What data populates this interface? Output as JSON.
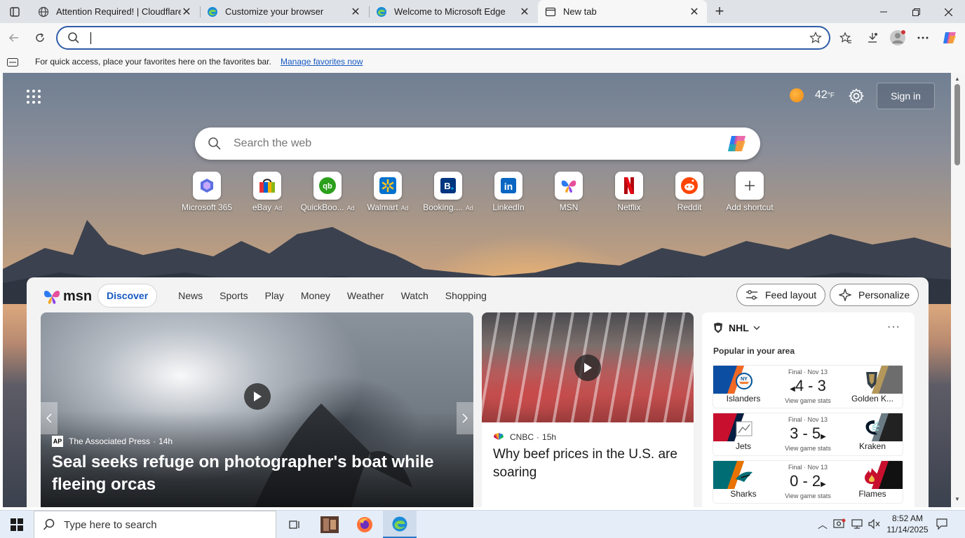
{
  "tabs": [
    {
      "title": "Attention Required! | Cloudflare",
      "icon": "globe-icon"
    },
    {
      "title": "Customize your browser",
      "icon": "edge-icon"
    },
    {
      "title": "Welcome to Microsoft Edge",
      "icon": "edge-icon"
    },
    {
      "title": "New tab",
      "icon": "newtab-icon",
      "active": true
    }
  ],
  "address_bar": {
    "value": "",
    "placeholder": ""
  },
  "favorites_bar": {
    "message": "For quick access, place your favorites here on the favorites bar.",
    "link": "Manage favorites now"
  },
  "ntp": {
    "weather": {
      "temp": "42",
      "unit": "°F",
      "icon": "sun-icon"
    },
    "sign_in": "Sign in",
    "search_placeholder": "Search the web",
    "shortcuts": [
      {
        "label": "Microsoft 365",
        "ad": ""
      },
      {
        "label": "eBay",
        "ad": "Ad"
      },
      {
        "label": "QuickBoo...",
        "ad": "Ad"
      },
      {
        "label": "Walmart",
        "ad": "Ad"
      },
      {
        "label": "Booking....",
        "ad": "Ad"
      },
      {
        "label": "LinkedIn",
        "ad": ""
      },
      {
        "label": "MSN",
        "ad": ""
      },
      {
        "label": "Netflix",
        "ad": ""
      },
      {
        "label": "Reddit",
        "ad": ""
      },
      {
        "label": "Add shortcut",
        "ad": ""
      }
    ]
  },
  "feed": {
    "brand": "msn",
    "nav": [
      "Discover",
      "News",
      "Sports",
      "Play",
      "Money",
      "Weather",
      "Watch",
      "Shopping"
    ],
    "feed_layout": "Feed layout",
    "personalize": "Personalize",
    "main_story": {
      "source": "The Associated Press",
      "source_badge": "AP",
      "age": "14h",
      "headline": "Seal seeks refuge on photographer's boat while fleeing orcas"
    },
    "second_story": {
      "source": "CNBC",
      "age": "15h",
      "headline": "Why beef prices in the U.S. are soaring"
    },
    "nhl": {
      "title": "NHL",
      "subtitle": "Popular in your area",
      "games": [
        {
          "status": "Final · Nov 13",
          "home": "Islanders",
          "away": "Golden K...",
          "score_home": "4",
          "score_away": "3",
          "stats": "View game stats",
          "winner": "home",
          "color_home": "#0b4ea2",
          "color_away": "#5a5a5a"
        },
        {
          "status": "Final · Nov 13",
          "home": "Jets",
          "away": "Kraken",
          "score_home": "3",
          "score_away": "5",
          "stats": "View game stats",
          "winner": "away",
          "color_home": "#c8102e",
          "color_away": "#222222"
        },
        {
          "status": "Final · Nov 13",
          "home": "Sharks",
          "away": "Flames",
          "score_home": "0",
          "score_away": "2",
          "stats": "View game stats",
          "winner": "away",
          "color_home": "#006d75",
          "color_away": "#222222"
        }
      ]
    }
  },
  "taskbar": {
    "search_placeholder": "Type here to search",
    "time": "8:52 AM",
    "date": "11/14/2025"
  }
}
